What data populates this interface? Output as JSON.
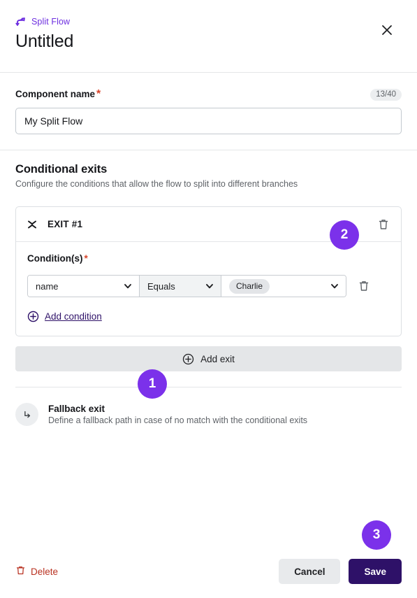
{
  "header": {
    "eyebrow_label": "Split Flow",
    "eyebrow_icon": "split-flow-icon",
    "title": "Untitled",
    "close_icon": "close-icon"
  },
  "component_name": {
    "label": "Component name",
    "required_marker": "*",
    "counter": "13/40",
    "value": "My Split Flow",
    "placeholder": "Component name"
  },
  "conditional_exits": {
    "title": "Conditional exits",
    "subtitle": "Configure the conditions that allow the flow to split into different branches",
    "exits": [
      {
        "label": "EXIT #1",
        "collapse_icon": "collapse-icon",
        "delete_icon": "trash-icon",
        "conditions_label": "Condition(s)",
        "required_marker": "*",
        "condition": {
          "field": "name",
          "operator": "Equals",
          "value": "Charlie",
          "delete_icon": "trash-icon",
          "caret_icon": "chevron-down-icon"
        },
        "add_condition_label": "Add condition",
        "add_condition_icon": "plus-circle-icon"
      }
    ],
    "add_exit_label": "Add exit",
    "add_exit_icon": "plus-circle-icon"
  },
  "fallback_exit": {
    "icon": "arrow-turn-down-right-icon",
    "title": "Fallback exit",
    "subtitle": "Define a fallback path in case of no match with the conditional exits"
  },
  "footer": {
    "delete_label": "Delete",
    "delete_icon": "trash-icon",
    "cancel_label": "Cancel",
    "save_label": "Save"
  },
  "step_badges": [
    {
      "number": "1"
    },
    {
      "number": "2"
    },
    {
      "number": "3"
    }
  ],
  "colors": {
    "accent_purple": "#7b31ea",
    "brand_purple": "#6d2fe0",
    "save_dark_purple": "#2e1168",
    "link_purple": "#2e1168",
    "danger_red": "#b93221",
    "required_star": "#d8452b",
    "muted_text": "#5f6368",
    "border": "#dcdfe3",
    "bar_gray": "#e4e6e8"
  }
}
